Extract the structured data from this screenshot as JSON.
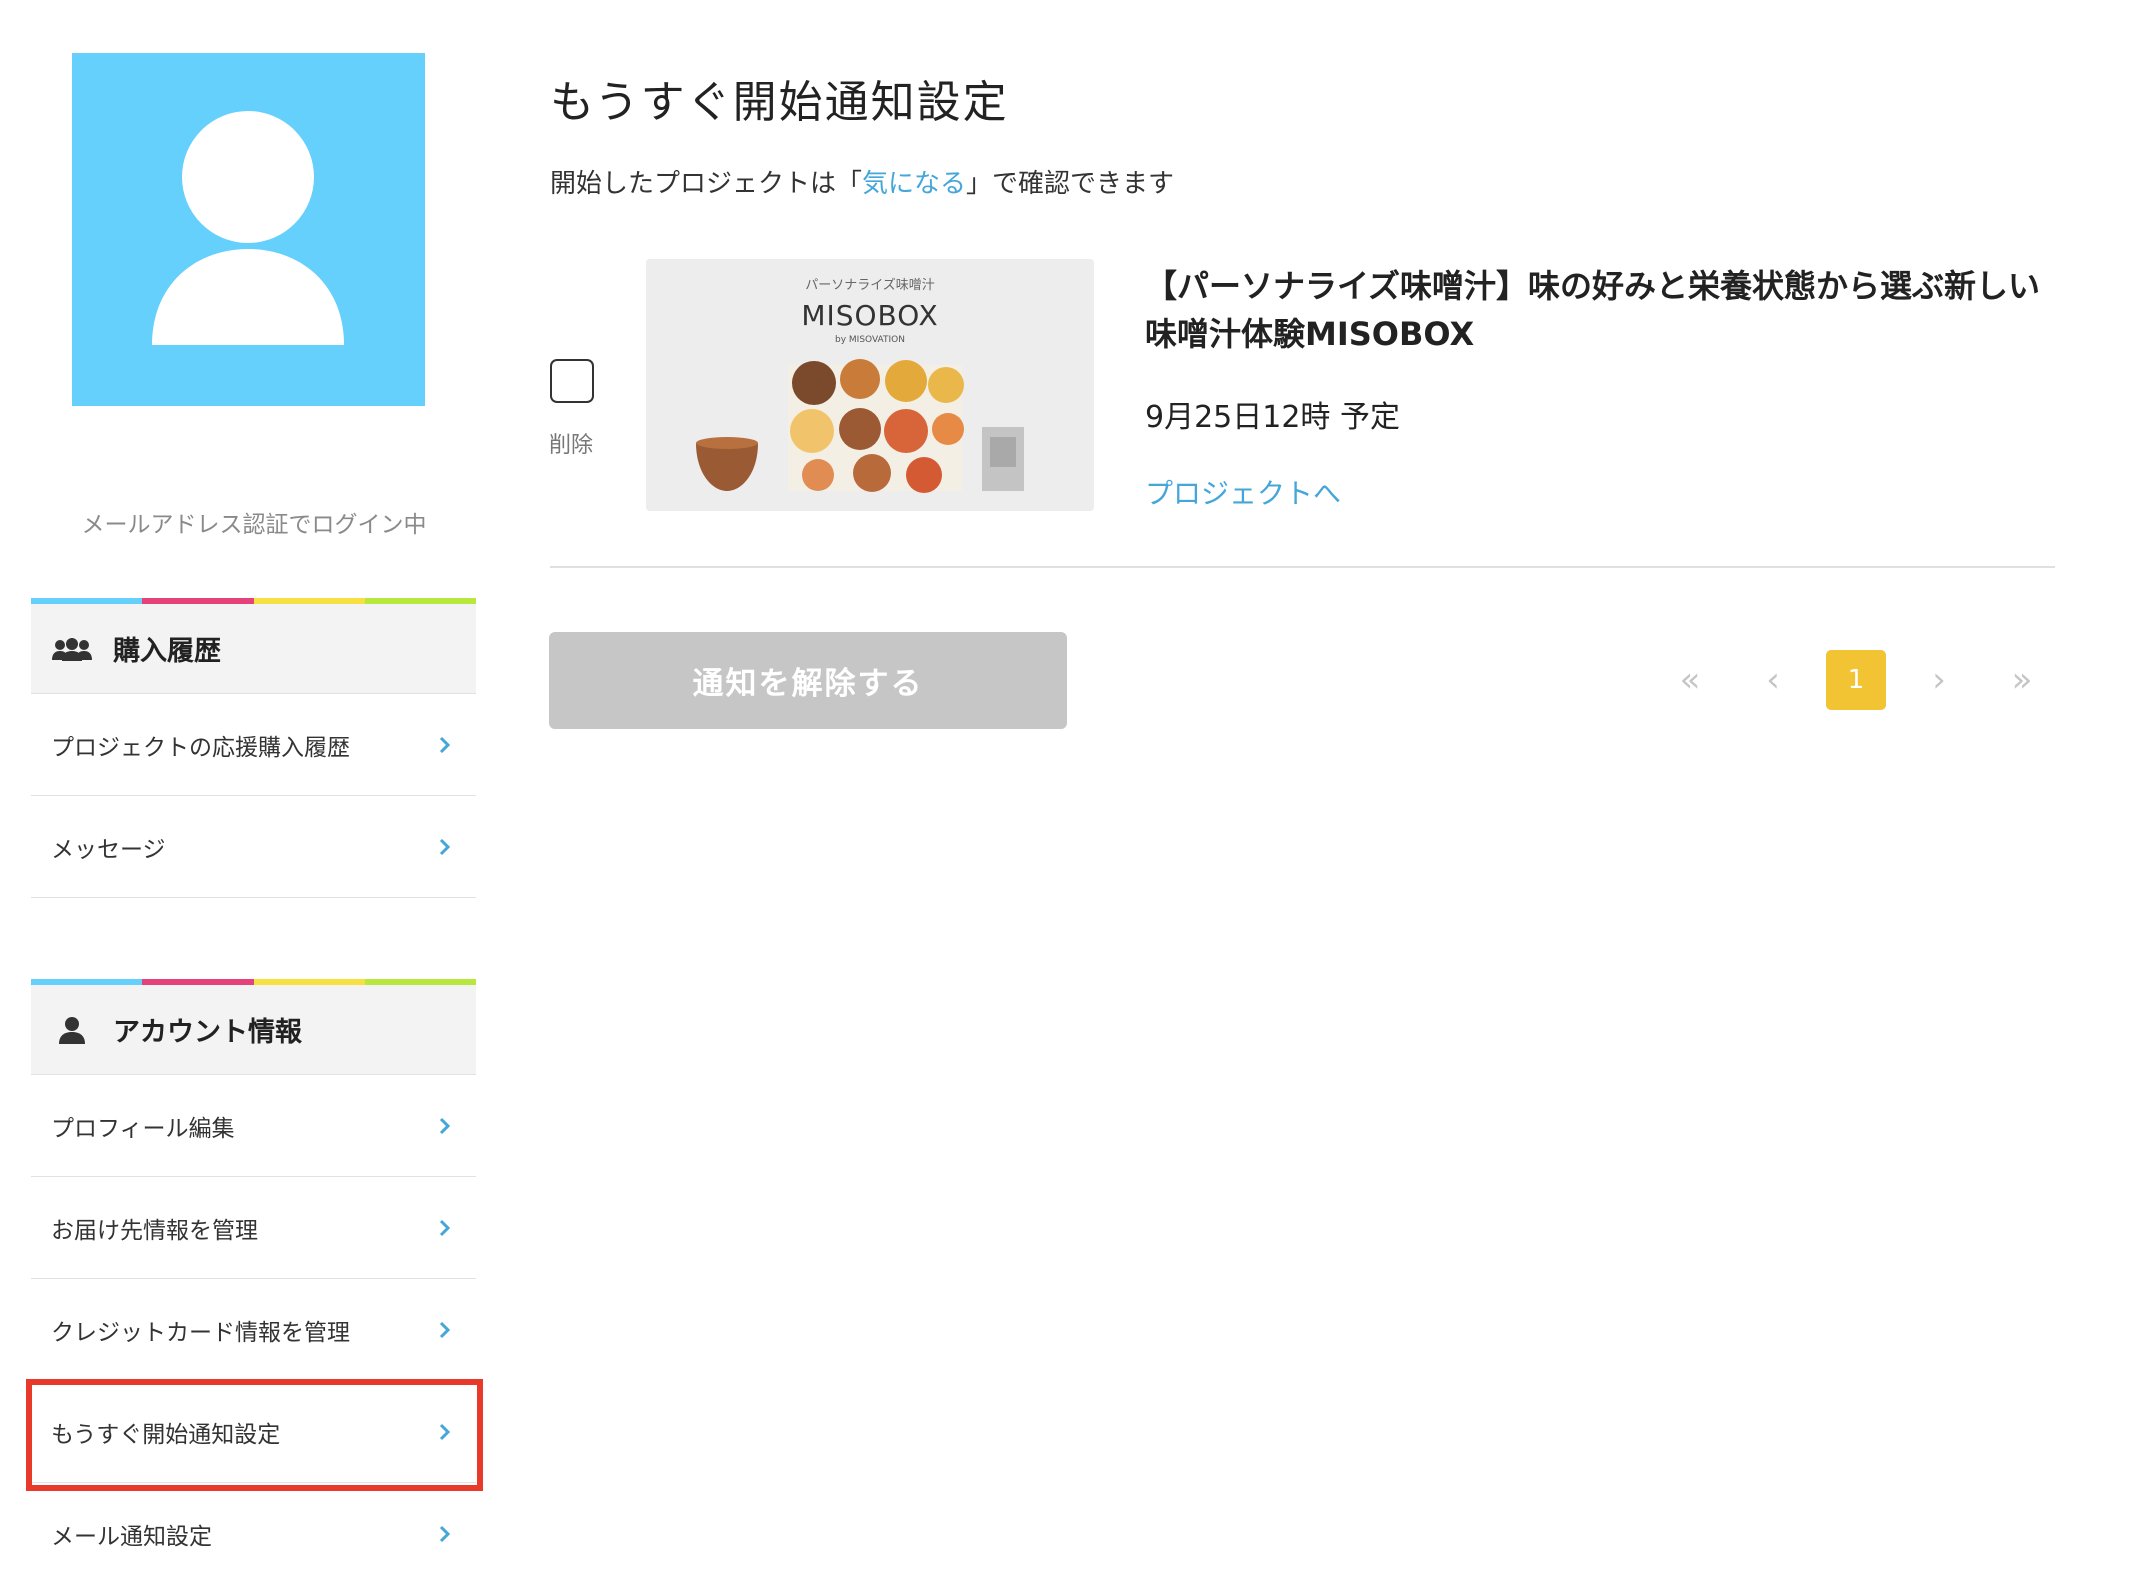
{
  "sidebar": {
    "login_status": "メールアドレス認証でログイン中",
    "stripe_colors": [
      "#64d0fb",
      "#e5427a",
      "#f7e042",
      "#b8e83d"
    ],
    "sections": [
      {
        "header": "購入履歴",
        "icon": "users-icon",
        "items": [
          {
            "label": "プロジェクトの応援購入履歴"
          },
          {
            "label": "メッセージ"
          }
        ]
      },
      {
        "header": "アカウント情報",
        "icon": "user-icon",
        "items": [
          {
            "label": "プロフィール編集"
          },
          {
            "label": "お届け先情報を管理"
          },
          {
            "label": "クレジットカード情報を管理"
          },
          {
            "label": "もうすぐ開始通知設定"
          },
          {
            "label": "メール通知設定"
          }
        ]
      }
    ]
  },
  "main": {
    "title": "もうすぐ開始通知設定",
    "subtitle_prefix": "開始したプロジェクトは「",
    "subtitle_link": "気になる",
    "subtitle_suffix": "」で確認できます",
    "project": {
      "delete_label": "削除",
      "title": "【パーソナライズ味噌汁】味の好みと栄養状態から選ぶ新しい味噌汁体験MISOBOX",
      "date": "9月25日12時 予定",
      "link": "プロジェクトへ",
      "thumb_caption": "パーソナライズ味噌汁",
      "thumb_brand": "MISOBOX",
      "thumb_by": "by MISOVATION"
    },
    "cancel_button": "通知を解除する",
    "pagination": {
      "first": "«",
      "prev": "‹",
      "current": "1",
      "next": "›",
      "last": "»"
    }
  },
  "colors": {
    "accent_blue": "#45a7d9",
    "avatar_bg": "#64d0fb",
    "page_active": "#f2c433",
    "highlight": "#e8392b"
  }
}
